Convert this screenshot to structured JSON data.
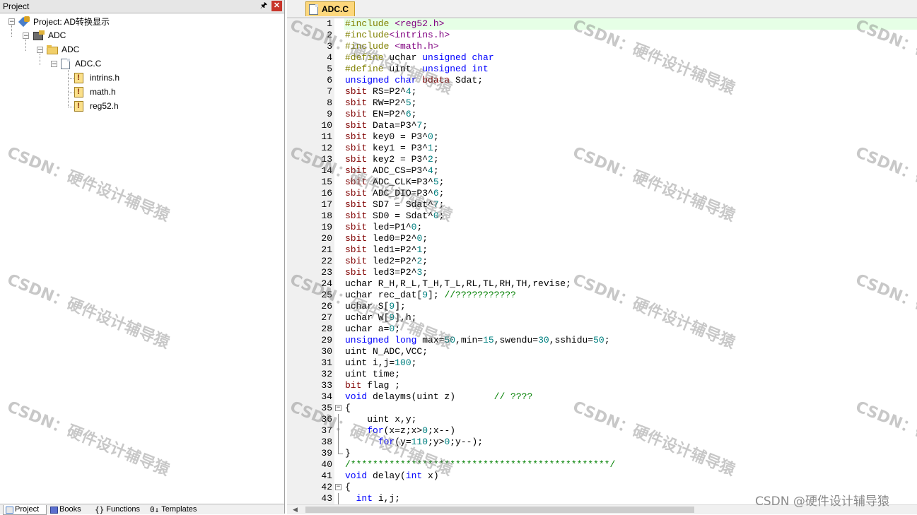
{
  "project_panel": {
    "title": "Project",
    "tree": {
      "root": "Project: AD转换显示",
      "target": "ADC",
      "group": "ADC",
      "file": "ADC.C",
      "includes": [
        "intrins.h",
        "math.h",
        "reg52.h"
      ]
    },
    "tabs": [
      "Project",
      "Books",
      "Functions",
      "Templates"
    ]
  },
  "editor": {
    "tab": "ADC.C",
    "lines": [
      [
        {
          "t": "#include ",
          "c": "pp"
        },
        {
          "t": "<reg52.h>",
          "c": "str"
        }
      ],
      [
        {
          "t": "#include",
          "c": "pp"
        },
        {
          "t": "<intrins.h>",
          "c": "str"
        }
      ],
      [
        {
          "t": "#include ",
          "c": "pp"
        },
        {
          "t": "<math.h>",
          "c": "str"
        }
      ],
      [
        {
          "t": "#define ",
          "c": "pp"
        },
        {
          "t": "uchar "
        },
        {
          "t": "unsigned char",
          "c": "kw"
        }
      ],
      [
        {
          "t": "#define ",
          "c": "pp"
        },
        {
          "t": "uint  "
        },
        {
          "t": "unsigned int",
          "c": "kw"
        }
      ],
      [
        {
          "t": "unsigned char ",
          "c": "kw"
        },
        {
          "t": "bdata ",
          "c": "typ"
        },
        {
          "t": "Sdat;"
        }
      ],
      [
        {
          "t": "sbit ",
          "c": "typ"
        },
        {
          "t": "RS=P2^"
        },
        {
          "t": "4",
          "c": "num"
        },
        {
          "t": ";"
        }
      ],
      [
        {
          "t": "sbit ",
          "c": "typ"
        },
        {
          "t": "RW=P2^"
        },
        {
          "t": "5",
          "c": "num"
        },
        {
          "t": ";"
        }
      ],
      [
        {
          "t": "sbit ",
          "c": "typ"
        },
        {
          "t": "EN=P2^"
        },
        {
          "t": "6",
          "c": "num"
        },
        {
          "t": ";"
        }
      ],
      [
        {
          "t": "sbit ",
          "c": "typ"
        },
        {
          "t": "Data=P3^"
        },
        {
          "t": "7",
          "c": "num"
        },
        {
          "t": ";"
        }
      ],
      [
        {
          "t": "sbit ",
          "c": "typ"
        },
        {
          "t": "key0 = P3^"
        },
        {
          "t": "0",
          "c": "num"
        },
        {
          "t": ";"
        }
      ],
      [
        {
          "t": "sbit ",
          "c": "typ"
        },
        {
          "t": "key1 = P3^"
        },
        {
          "t": "1",
          "c": "num"
        },
        {
          "t": ";"
        }
      ],
      [
        {
          "t": "sbit ",
          "c": "typ"
        },
        {
          "t": "key2 = P3^"
        },
        {
          "t": "2",
          "c": "num"
        },
        {
          "t": ";"
        }
      ],
      [
        {
          "t": "sbit ",
          "c": "typ"
        },
        {
          "t": "ADC_CS=P3^"
        },
        {
          "t": "4",
          "c": "num"
        },
        {
          "t": ";"
        }
      ],
      [
        {
          "t": "sbit ",
          "c": "typ"
        },
        {
          "t": "ADC_CLK=P3^"
        },
        {
          "t": "5",
          "c": "num"
        },
        {
          "t": ";"
        }
      ],
      [
        {
          "t": "sbit ",
          "c": "typ"
        },
        {
          "t": "ADC_DIO=P3^"
        },
        {
          "t": "6",
          "c": "num"
        },
        {
          "t": ";"
        }
      ],
      [
        {
          "t": "sbit ",
          "c": "typ"
        },
        {
          "t": "SD7 = Sdat^"
        },
        {
          "t": "7",
          "c": "num"
        },
        {
          "t": ";"
        }
      ],
      [
        {
          "t": "sbit ",
          "c": "typ"
        },
        {
          "t": "SD0 = Sdat^"
        },
        {
          "t": "0",
          "c": "num"
        },
        {
          "t": ";"
        }
      ],
      [
        {
          "t": "sbit ",
          "c": "typ"
        },
        {
          "t": "led=P1^"
        },
        {
          "t": "0",
          "c": "num"
        },
        {
          "t": ";"
        }
      ],
      [
        {
          "t": "sbit ",
          "c": "typ"
        },
        {
          "t": "led0=P2^"
        },
        {
          "t": "0",
          "c": "num"
        },
        {
          "t": ";"
        }
      ],
      [
        {
          "t": "sbit ",
          "c": "typ"
        },
        {
          "t": "led1=P2^"
        },
        {
          "t": "1",
          "c": "num"
        },
        {
          "t": ";"
        }
      ],
      [
        {
          "t": "sbit ",
          "c": "typ"
        },
        {
          "t": "led2=P2^"
        },
        {
          "t": "2",
          "c": "num"
        },
        {
          "t": ";"
        }
      ],
      [
        {
          "t": "sbit ",
          "c": "typ"
        },
        {
          "t": "led3=P2^"
        },
        {
          "t": "3",
          "c": "num"
        },
        {
          "t": ";"
        }
      ],
      [
        {
          "t": "uchar R_H,R_L,T_H,T_L,RL,TL,RH,TH,revise;"
        }
      ],
      [
        {
          "t": "uchar rec_dat["
        },
        {
          "t": "9",
          "c": "num"
        },
        {
          "t": "]; "
        },
        {
          "t": "//???????????",
          "c": "cmt"
        }
      ],
      [
        {
          "t": "uchar S["
        },
        {
          "t": "9",
          "c": "num"
        },
        {
          "t": "];"
        }
      ],
      [
        {
          "t": "uchar W["
        },
        {
          "t": "9",
          "c": "num"
        },
        {
          "t": "],h;"
        }
      ],
      [
        {
          "t": "uchar a="
        },
        {
          "t": "0",
          "c": "num"
        },
        {
          "t": ";"
        }
      ],
      [
        {
          "t": "unsigned long ",
          "c": "kw"
        },
        {
          "t": "max="
        },
        {
          "t": "50",
          "c": "num"
        },
        {
          "t": ",min="
        },
        {
          "t": "15",
          "c": "num"
        },
        {
          "t": ",swendu="
        },
        {
          "t": "30",
          "c": "num"
        },
        {
          "t": ",sshidu="
        },
        {
          "t": "50",
          "c": "num"
        },
        {
          "t": ";"
        }
      ],
      [
        {
          "t": "uint N_ADC,VCC;"
        }
      ],
      [
        {
          "t": "uint i,j="
        },
        {
          "t": "100",
          "c": "num"
        },
        {
          "t": ";"
        }
      ],
      [
        {
          "t": "uint time;"
        }
      ],
      [
        {
          "t": "bit ",
          "c": "typ"
        },
        {
          "t": "flag ;"
        }
      ],
      [
        {
          "t": "void ",
          "c": "kw"
        },
        {
          "t": "delayms(uint z)       "
        },
        {
          "t": "// ????",
          "c": "cmt"
        }
      ],
      [
        {
          "t": "{"
        }
      ],
      [
        {
          "t": "    uint x,y;"
        }
      ],
      [
        {
          "t": "    "
        },
        {
          "t": "for",
          "c": "kw"
        },
        {
          "t": "(x=z;x>"
        },
        {
          "t": "0",
          "c": "num"
        },
        {
          "t": ";x--)"
        }
      ],
      [
        {
          "t": "      "
        },
        {
          "t": "for",
          "c": "kw"
        },
        {
          "t": "(y="
        },
        {
          "t": "110",
          "c": "num"
        },
        {
          "t": ";y>"
        },
        {
          "t": "0",
          "c": "num"
        },
        {
          "t": ";y--);"
        }
      ],
      [
        {
          "t": "}"
        }
      ],
      [
        {
          "t": "/***********************************************/",
          "c": "cmt"
        }
      ],
      [
        {
          "t": "void ",
          "c": "kw"
        },
        {
          "t": "delay("
        },
        {
          "t": "int ",
          "c": "kw"
        },
        {
          "t": "x)"
        }
      ],
      [
        {
          "t": "{"
        }
      ],
      [
        {
          "t": "  "
        },
        {
          "t": "int ",
          "c": "kw"
        },
        {
          "t": "i,j;"
        }
      ]
    ],
    "fold_open_lines": [
      35,
      42
    ],
    "fold_close_lines": [
      39
    ],
    "fold_inner_lines": [
      36,
      37,
      38,
      43
    ]
  },
  "watermark": {
    "text": "CSDN：硬件设计辅导猿",
    "corner": "CSDN @硬件设计辅导猿"
  }
}
